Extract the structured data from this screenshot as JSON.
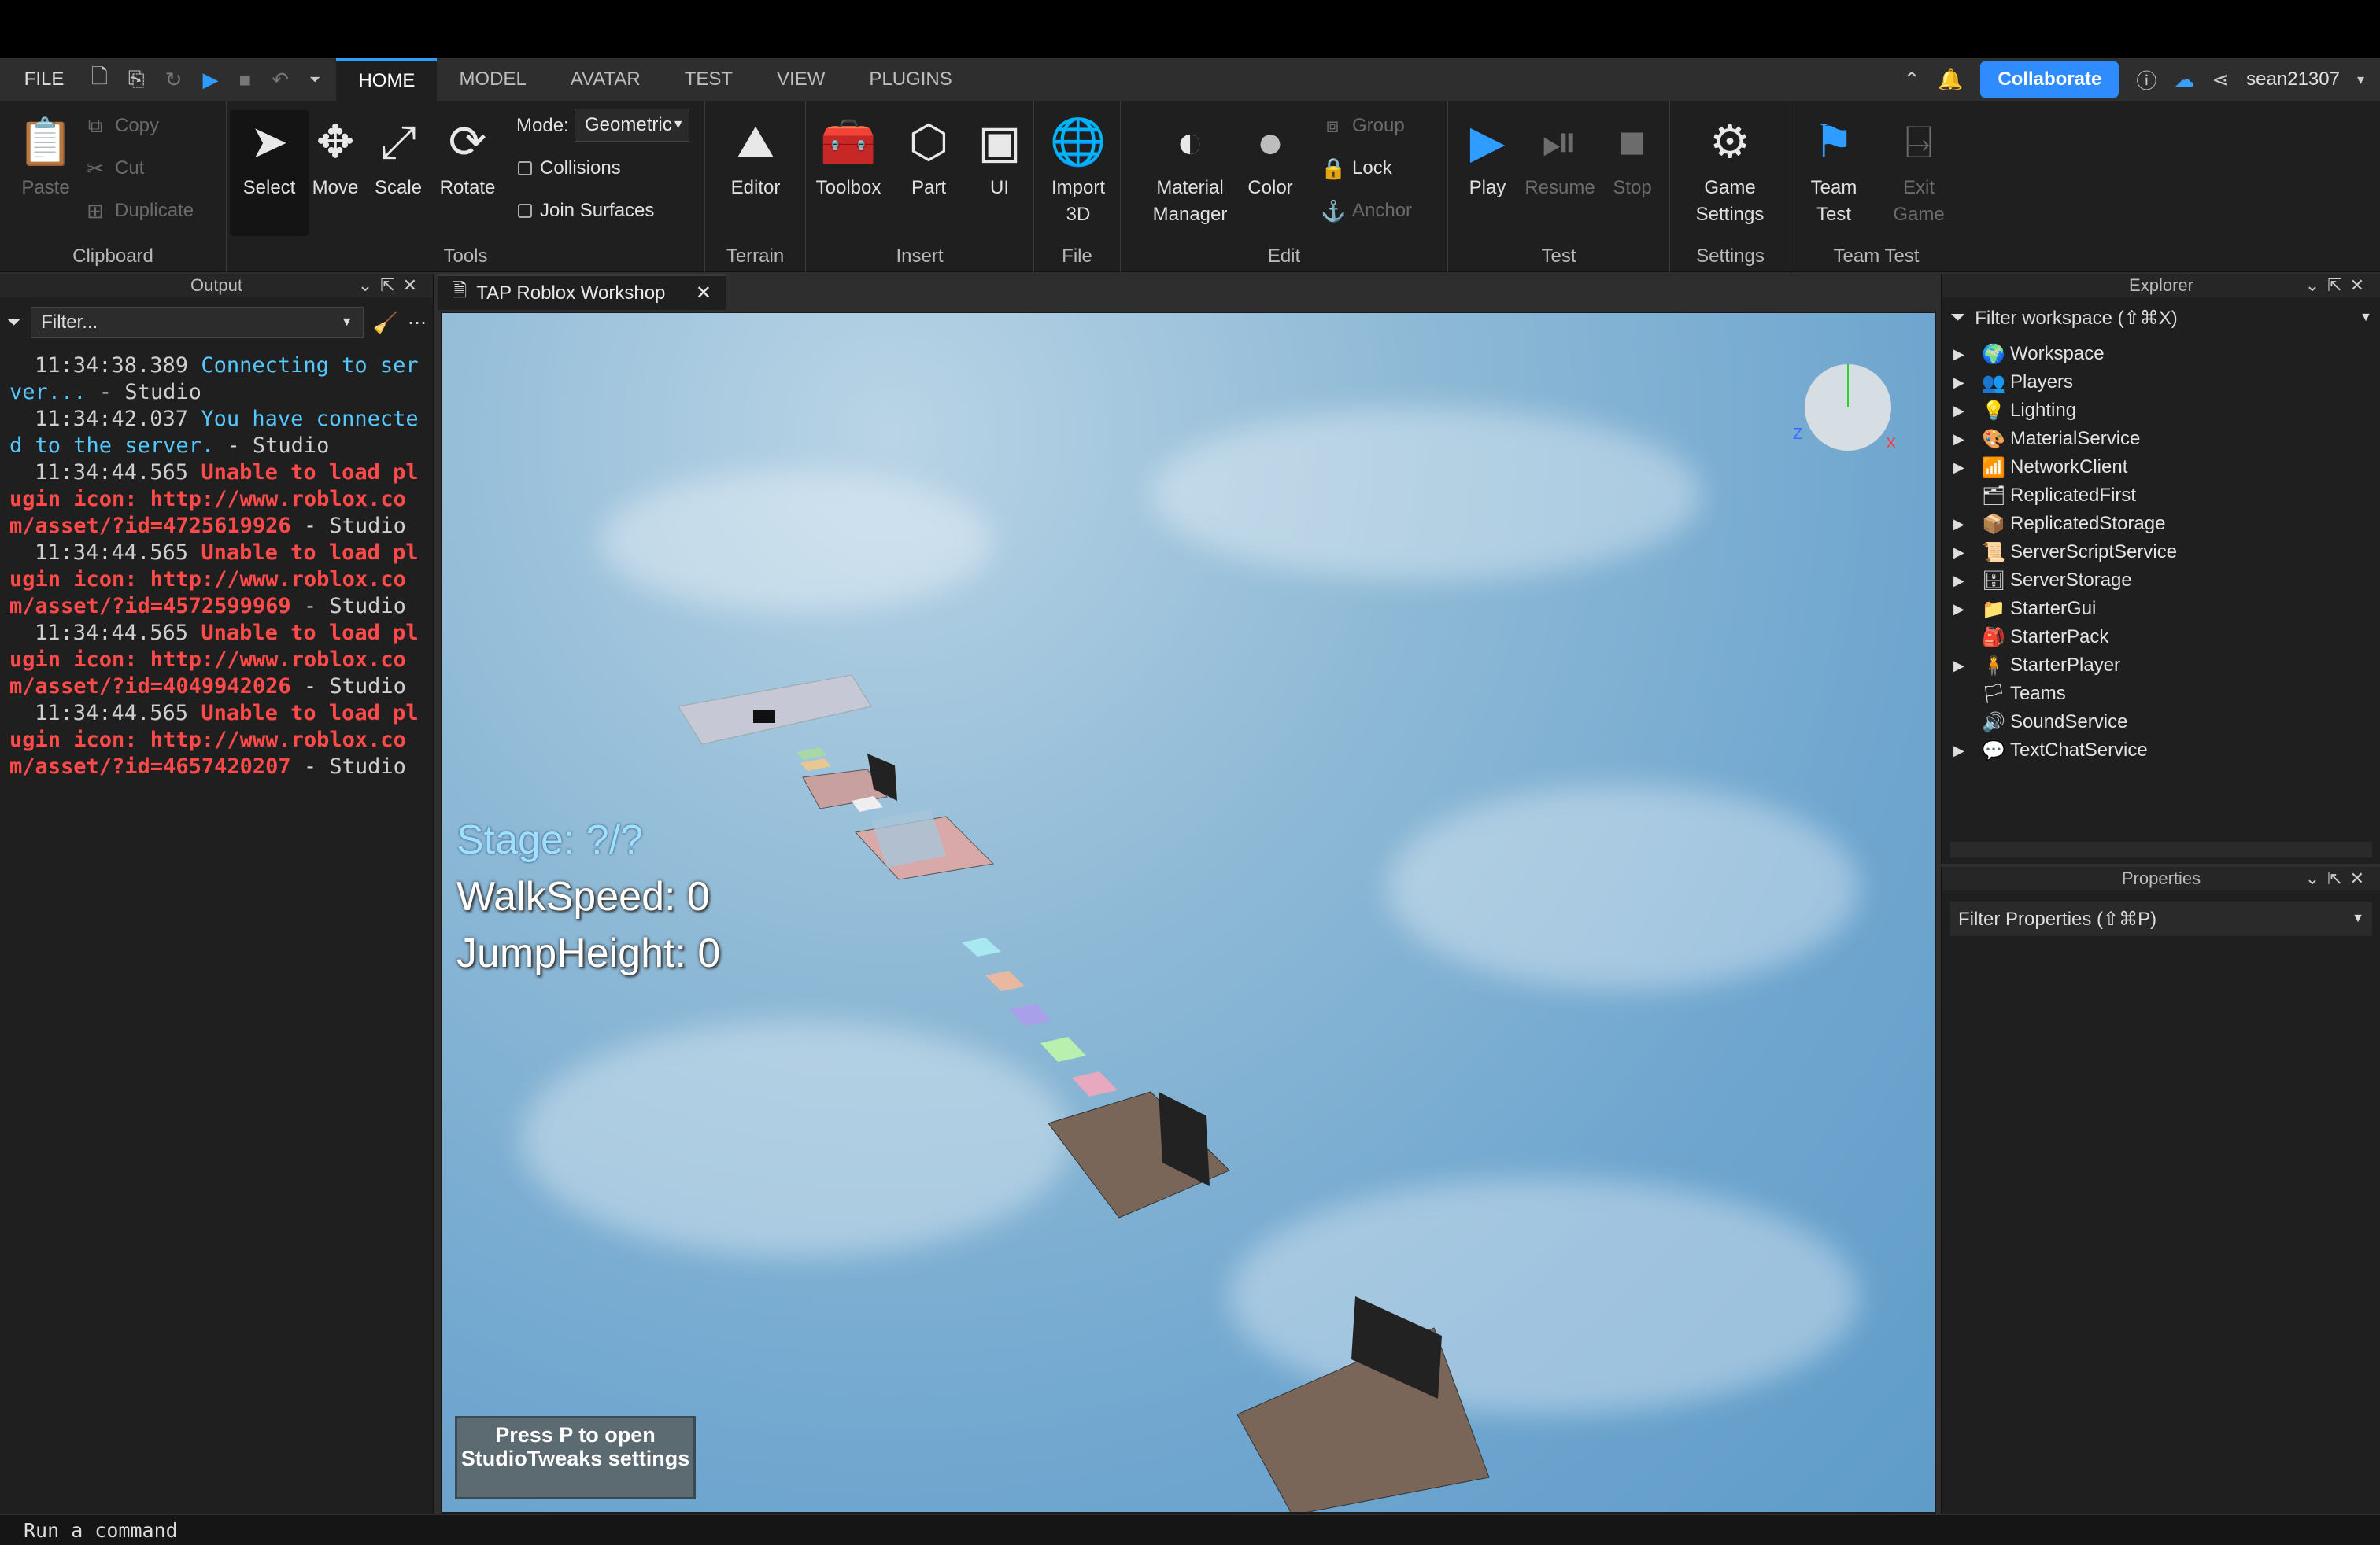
{
  "menubar": {
    "file": "FILE",
    "tabs": [
      "HOME",
      "MODEL",
      "AVATAR",
      "TEST",
      "VIEW",
      "PLUGINS"
    ],
    "collaborate": "Collaborate",
    "username": "sean21307"
  },
  "ribbon": {
    "clipboard": {
      "label": "Clipboard",
      "paste": "Paste",
      "copy": "Copy",
      "cut": "Cut",
      "duplicate": "Duplicate"
    },
    "tools": {
      "label": "Tools",
      "select": "Select",
      "move": "Move",
      "scale": "Scale",
      "rotate": "Rotate",
      "mode_label": "Mode:",
      "mode_value": "Geometric",
      "collisions": "Collisions",
      "join_surfaces": "Join Surfaces"
    },
    "terrain": {
      "label": "Terrain",
      "editor": "Editor"
    },
    "insert": {
      "label": "Insert",
      "toolbox": "Toolbox",
      "part": "Part",
      "ui": "UI"
    },
    "file": {
      "label": "File",
      "import": "Import",
      "import2": "3D"
    },
    "edit": {
      "label": "Edit",
      "material": "Material",
      "material2": "Manager",
      "color": "Color",
      "group": "Group",
      "lock": "Lock",
      "anchor": "Anchor"
    },
    "test": {
      "label": "Test",
      "play": "Play",
      "resume": "Resume",
      "stop": "Stop"
    },
    "settings": {
      "label": "Settings",
      "game": "Game",
      "game2": "Settings"
    },
    "teamtest": {
      "label": "Team Test",
      "team": "Team",
      "team2": "Test",
      "exit": "Exit",
      "exit2": "Game"
    }
  },
  "output": {
    "title": "Output",
    "filter_placeholder": "Filter...",
    "logs": [
      {
        "time": "11:34:38.389",
        "msg": "Connecting to server...",
        "kind": "info",
        "src": "Studio"
      },
      {
        "time": "11:34:42.037",
        "msg": "You have connected to the server.",
        "kind": "info",
        "src": "Studio"
      },
      {
        "time": "11:34:44.565",
        "msg": "Unable to load plugin icon: http://www.roblox.com/asset/?id=4725619926",
        "kind": "err",
        "src": "Studio"
      },
      {
        "time": "11:34:44.565",
        "msg": "Unable to load plugin icon: http://www.roblox.com/asset/?id=4572599969",
        "kind": "err",
        "src": "Studio"
      },
      {
        "time": "11:34:44.565",
        "msg": "Unable to load plugin icon: http://www.roblox.com/asset/?id=4049942026",
        "kind": "err",
        "src": "Studio"
      },
      {
        "time": "11:34:44.565",
        "msg": "Unable to load plugin icon: http://www.roblox.com/asset/?id=4657420207",
        "kind": "err",
        "src": "Studio"
      }
    ]
  },
  "viewport": {
    "tab_title": "TAP Roblox Workshop",
    "stage": "Stage: ?/?",
    "walkspeed": "WalkSpeed: 0",
    "jumpheight": "JumpHeight: 0",
    "tweak_button": "Press P to open StudioTweaks settings"
  },
  "explorer": {
    "title": "Explorer",
    "filter": "Filter workspace (⇧⌘X)",
    "items": [
      {
        "name": "Workspace",
        "icon": "🌍",
        "expand": true
      },
      {
        "name": "Players",
        "icon": "👥",
        "expand": true
      },
      {
        "name": "Lighting",
        "icon": "💡",
        "expand": true
      },
      {
        "name": "MaterialService",
        "icon": "🎨",
        "expand": true
      },
      {
        "name": "NetworkClient",
        "icon": "📶",
        "expand": true
      },
      {
        "name": "ReplicatedFirst",
        "icon": "🗂",
        "expand": false
      },
      {
        "name": "ReplicatedStorage",
        "icon": "📦",
        "expand": true
      },
      {
        "name": "ServerScriptService",
        "icon": "📜",
        "expand": true
      },
      {
        "name": "ServerStorage",
        "icon": "🗄",
        "expand": true
      },
      {
        "name": "StarterGui",
        "icon": "📁",
        "expand": true
      },
      {
        "name": "StarterPack",
        "icon": "🎒",
        "expand": false
      },
      {
        "name": "StarterPlayer",
        "icon": "🧍",
        "expand": true
      },
      {
        "name": "Teams",
        "icon": "🏳",
        "expand": false
      },
      {
        "name": "SoundService",
        "icon": "🔊",
        "expand": false
      },
      {
        "name": "TextChatService",
        "icon": "💬",
        "expand": true
      }
    ]
  },
  "properties": {
    "title": "Properties",
    "filter": "Filter Properties (⇧⌘P)"
  },
  "command_bar": {
    "placeholder": "Run a command"
  },
  "colors": {
    "accent": "#2f9cff",
    "error": "#ff4a4a",
    "info": "#55c8ff"
  }
}
